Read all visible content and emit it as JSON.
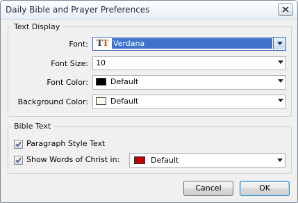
{
  "window": {
    "title": "Daily Bible and Prayer Preferences"
  },
  "text_display": {
    "legend": "Text Display",
    "font": {
      "label": "Font:",
      "value": "Verdana",
      "icon": "truetype-font-icon"
    },
    "font_size": {
      "label": "Font Size:",
      "value": "10"
    },
    "font_color": {
      "label": "Font Color:",
      "value": "Default",
      "swatch_color": "#000000"
    },
    "background_color": {
      "label": "Background Color:",
      "value": "Default",
      "swatch_color": "#fdfaf0"
    }
  },
  "bible_text": {
    "legend": "Bible Text",
    "paragraph_style": {
      "label": "Paragraph Style Text",
      "checked": true
    },
    "words_of_christ": {
      "label": "Show Words of Christ in:",
      "checked": true,
      "value": "Default",
      "swatch_color": "#c00000"
    }
  },
  "buttons": {
    "cancel": "Cancel",
    "ok": "OK"
  },
  "colors": {
    "selection": "#3f73c9",
    "accent_border": "#3f6ab5"
  }
}
